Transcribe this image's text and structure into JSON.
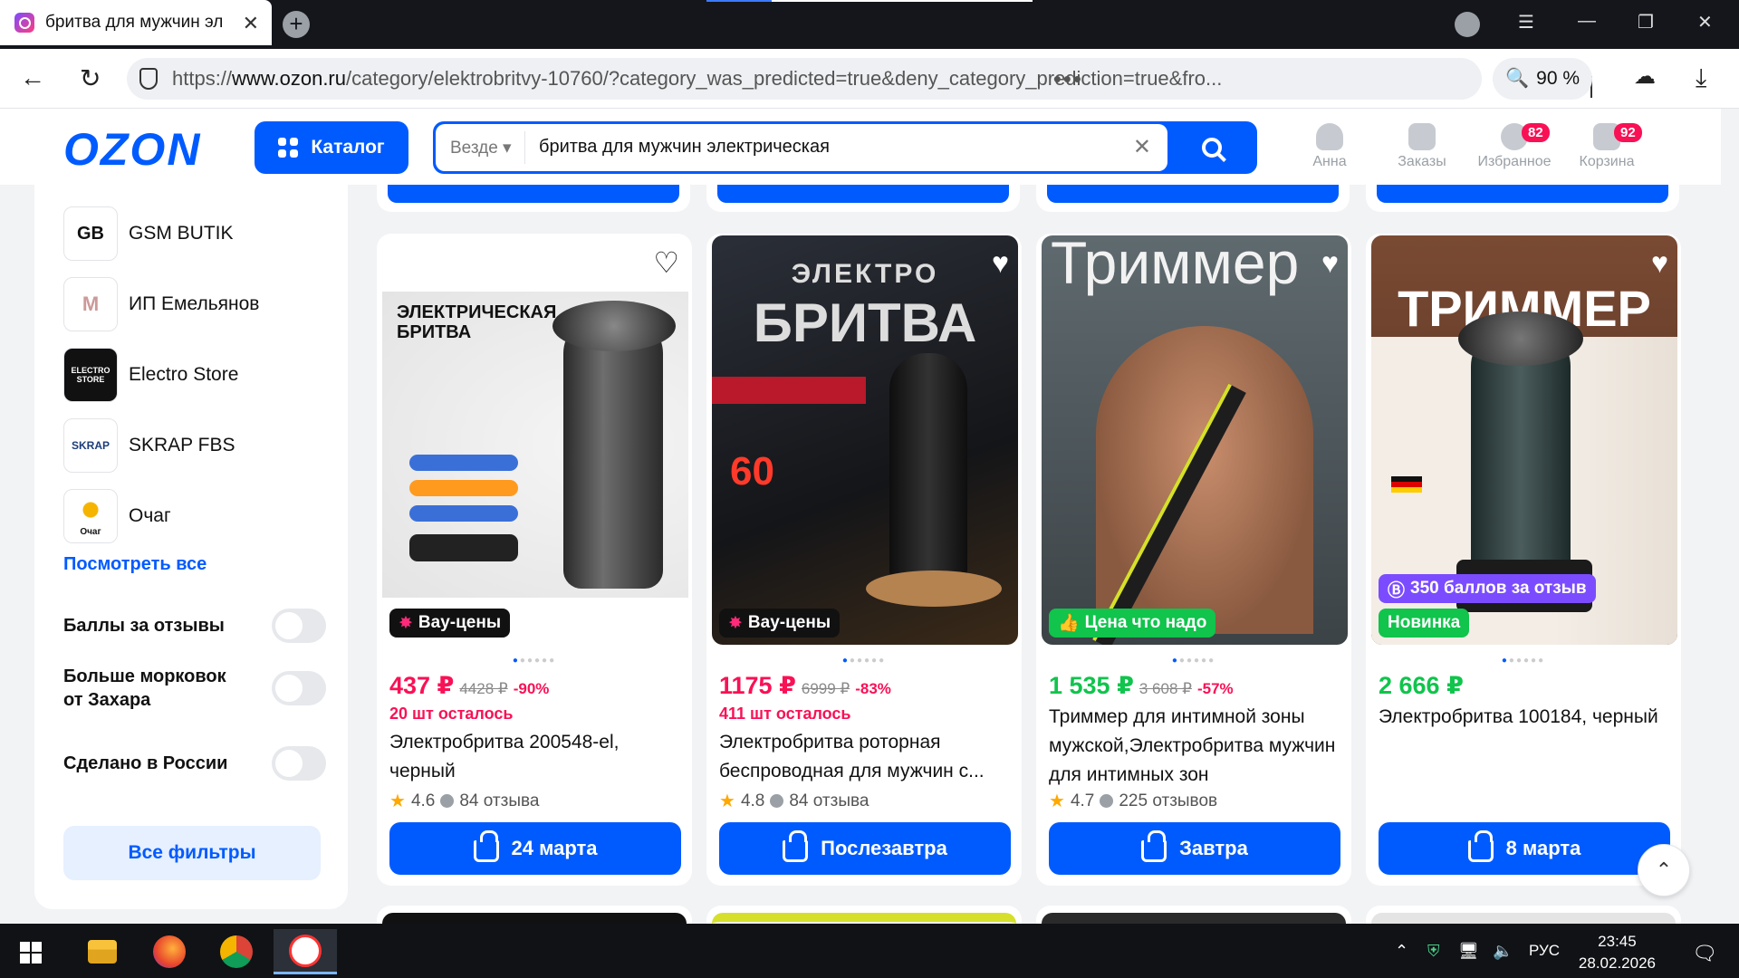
{
  "browser": {
    "tab_title": "бритва для мужчин эл",
    "tab_close": "✕",
    "new_tab": "+",
    "url_host_prefix": "https://",
    "url_host": "www.ozon.ru",
    "url_path": "/category/elektrobritvy-10760/?category_was_predicted=true&deny_category_prediction=true&fro...",
    "url_more": "•••",
    "zoom": "90 %"
  },
  "header": {
    "logo": "OZON",
    "catalog_label": "Каталог",
    "search_scope": "Везде",
    "search_value": "бритва для мужчин электрическая",
    "items": [
      {
        "label": "Анна",
        "badge": ""
      },
      {
        "label": "Заказы",
        "badge": ""
      },
      {
        "label": "Избранное",
        "badge": "82"
      },
      {
        "label": "Корзина",
        "badge": "92"
      }
    ]
  },
  "sidebar": {
    "sellers": [
      {
        "name": "GSM BUTIK",
        "logo": "GB"
      },
      {
        "name": "ИП Емельянов",
        "logo": "M"
      },
      {
        "name": "Electro Store",
        "logo": "ELECTRO STORE"
      },
      {
        "name": "SKRAP FBS",
        "logo": "SKRAP"
      },
      {
        "name": "Очаг",
        "logo": "Очаг"
      }
    ],
    "see_all": "Посмотреть все",
    "toggles": [
      {
        "label": "Баллы за отзывы",
        "on": false
      },
      {
        "label": "Больше морковок от Захара",
        "on": false
      },
      {
        "label": "Сделано в России",
        "on": false
      }
    ],
    "all_filters": "Все фильтры"
  },
  "products": [
    {
      "image_label": "Вау-цены",
      "image_text": [
        "ЭЛЕКТРИЧЕСКАЯ",
        "БРИТВА"
      ],
      "price": "437 ₽",
      "old_price": "4428 ₽",
      "discount": "-90%",
      "stock": "20 шт осталось",
      "title": "Электробритва 200548-el, черный",
      "rating": "4.6",
      "reviews": "84 отзыва",
      "delivery": "24 марта"
    },
    {
      "image_label": "Вау-цены",
      "image_text": [
        "ЭЛЕКТРО",
        "БРИТВА"
      ],
      "price": "1175 ₽",
      "old_price": "6999 ₽",
      "discount": "-83%",
      "stock": "411 шт осталось",
      "title": "Электробритва роторная беспроводная для мужчин с...",
      "rating": "4.8",
      "reviews": "84 отзыва",
      "delivery": "Послезавтра"
    },
    {
      "image_label": "Цена что надо",
      "image_text": [
        "Триммер"
      ],
      "price": "1 535 ₽",
      "old_price": "3 608 ₽",
      "discount": "-57%",
      "stock": "",
      "title": "Триммер для интимной зоны мужской,Электробритва мужчин для интимных зон",
      "rating": "4.7",
      "reviews": "225 отзывов",
      "delivery": "Завтра"
    },
    {
      "image_label": "Новинка",
      "image_badge": "350 баллов за отзыв",
      "image_text": [
        "ТРИММЕР"
      ],
      "price": "2 666 ₽",
      "old_price": "",
      "discount": "",
      "stock": "",
      "title": "Электробритва 100184, черный",
      "rating": "",
      "reviews": "",
      "delivery": "8 марта"
    }
  ],
  "taskbar": {
    "lang": "РУС",
    "time": "23:45",
    "date": "28.02.2026"
  },
  "colors": {
    "accent": "#005bff",
    "price_sale": "#f91155",
    "price_green": "#10c44c"
  }
}
